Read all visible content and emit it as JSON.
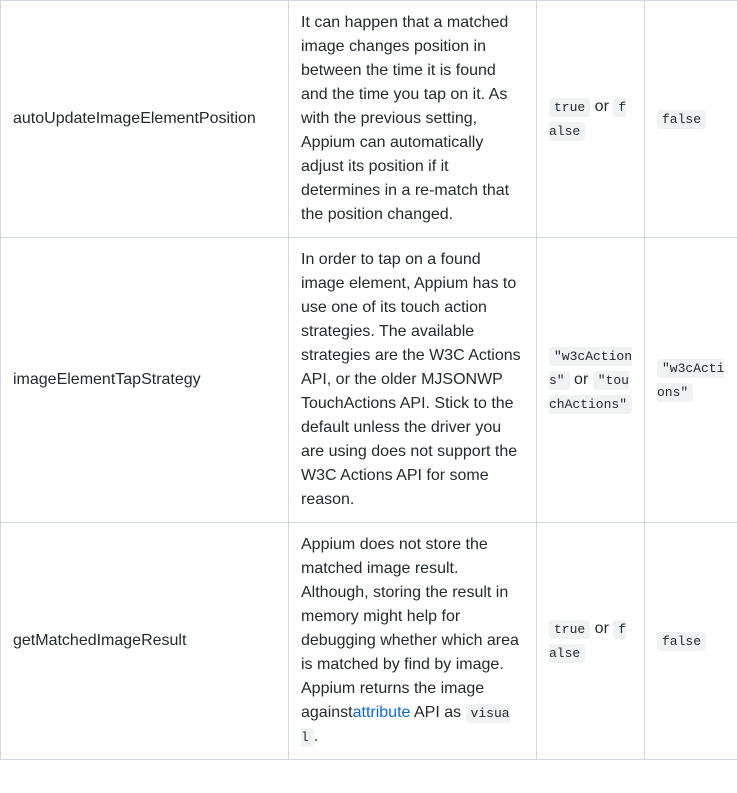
{
  "rows": [
    {
      "name": "autoUpdateImageElementPosition",
      "description": "It can happen that a matched image changes position in between the time it is found and the time you tap on it. As with the previous setting, Appium can automatically adjust its position if it determines in a re-match that the position changed.",
      "possible": {
        "val1": "true",
        "sep": " or ",
        "val2": "false"
      },
      "default": "false"
    },
    {
      "name": "imageElementTapStrategy",
      "description": "In order to tap on a found image element, Appium has to use one of its touch action strategies. The available strategies are the W3C Actions API, or the older MJSONWP TouchActions API. Stick to the default unless the driver you are using does not support the W3C Actions API for some reason.",
      "possible": {
        "val1": "\"w3cActions\"",
        "sep": " or ",
        "val2": "\"touchActions\""
      },
      "default": "\"w3cActions\""
    },
    {
      "name": "getMatchedImageResult",
      "desc_parts": {
        "p1": "Appium does not store the matched image result. Although, storing the result in memory might help for debugging whether which area is matched by find by image. Appium returns the image against",
        "link_text": "attribute",
        "p2": " API as ",
        "code_val": "visual",
        "p3": "."
      },
      "possible": {
        "val1": "true",
        "sep": " or ",
        "val2": "false"
      },
      "default": "false"
    }
  ]
}
